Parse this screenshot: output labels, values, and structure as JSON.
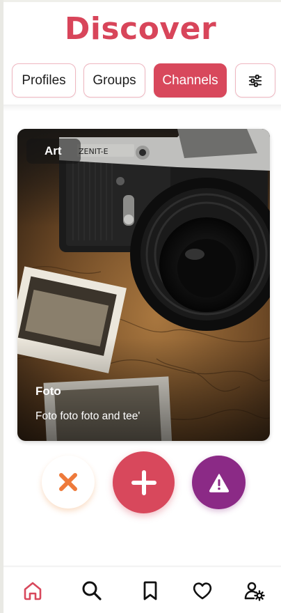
{
  "header": {
    "title": "Discover"
  },
  "tabs": [
    {
      "label": "Profiles",
      "active": false
    },
    {
      "label": "Groups",
      "active": false
    },
    {
      "label": "Channels",
      "active": true
    }
  ],
  "filter": {
    "icon": "sliders-icon"
  },
  "card": {
    "category": "Art",
    "title": "Foto",
    "description": "Foto foto foto and tee'",
    "image": "vintage camera on map with photos"
  },
  "actions": {
    "reject_icon": "close-icon",
    "add_icon": "plus-icon",
    "report_icon": "warning-icon"
  },
  "nav": [
    "home-icon",
    "search-icon",
    "bookmark-icon",
    "heart-icon",
    "user-settings-icon"
  ],
  "colors": {
    "accent": "#d8485c",
    "report": "#8b2a86",
    "reject": "#ee7a3b"
  }
}
